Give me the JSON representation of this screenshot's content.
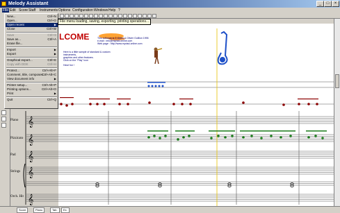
{
  "window": {
    "title": "Melody Assistant"
  },
  "menubar": {
    "items": [
      {
        "label": "File",
        "active": true
      },
      {
        "label": "Edit"
      },
      {
        "label": "Score"
      },
      {
        "label": "Staff"
      },
      {
        "label": "Instruments"
      },
      {
        "label": "Options"
      },
      {
        "label": "Configuration"
      },
      {
        "label": "Windows"
      },
      {
        "label": "Help"
      },
      {
        "label": "?"
      }
    ]
  },
  "tooltip": "File menu loading, saving, exporting, printing operations...",
  "file_menu": {
    "items": [
      {
        "label": "New...",
        "shortcut": "Ctrl+N"
      },
      {
        "label": "Open...",
        "shortcut": "Ctrl+O"
      },
      {
        "label": "Open recent",
        "submenu": true,
        "highlighted": true
      },
      {
        "label": "Close",
        "shortcut": "Ctrl+W"
      },
      {
        "sep": true
      },
      {
        "label": "Save",
        "shortcut": "Ctrl+S",
        "disabled": true
      },
      {
        "label": "Save as...",
        "shortcut": "Ctrl+A"
      },
      {
        "label": "Erase file...",
        "shortcut": ""
      },
      {
        "sep": true
      },
      {
        "label": "Import",
        "submenu": true
      },
      {
        "label": "Export",
        "submenu": true
      },
      {
        "sep": true
      },
      {
        "label": "Graphical export...",
        "shortcut": "Ctrl+E"
      },
      {
        "label": "Copy with DDE",
        "shortcut": "Ctrl+H",
        "disabled": true
      },
      {
        "sep": true
      },
      {
        "label": "Protect...",
        "shortcut": "Ctrl+Alt+F"
      },
      {
        "label": "Comment, title, composer...",
        "shortcut": "Ctrl+Alt+C"
      },
      {
        "label": "View document info",
        "submenu": true
      },
      {
        "sep": true
      },
      {
        "label": "Printer setup...",
        "shortcut": "Ctrl+Alt+P"
      },
      {
        "label": "Printing options...",
        "shortcut": "Ctrl+Alt+O"
      },
      {
        "label": "Print",
        "submenu": true
      },
      {
        "sep": true
      },
      {
        "label": "Quit",
        "shortcut": "Ctrl+Q"
      }
    ]
  },
  "ruler": {
    "marks": [
      "1",
      "2",
      "3",
      "4",
      "5"
    ]
  },
  "document": {
    "welcome": "LCOME",
    "info_lines": [
      "This software is © Didier & Olivier Guillion 1996",
      "e-mail : info@myriad-online.com",
      "Web page : http://www.myriad-online.com"
    ],
    "info2_lines": [
      "Here is a little sample of standard & custom instruments,",
      "graphics and other features.",
      "Click on the \"Play\" icon"
    ],
    "have_fun": "Have fun !"
  },
  "instruments": [
    {
      "label": "Piano"
    },
    {
      "label": "Pizzicato"
    },
    {
      "label": "Pad"
    },
    {
      "label": "Strings"
    },
    {
      "label": "Orch. Hit"
    }
  ],
  "bottom": {
    "tabs": [
      "Score",
      "Piano",
      "Tab.",
      "Ex."
    ]
  },
  "colors": {
    "menu_highlight": "#0a246a",
    "titlebar": "#0a246a",
    "note_red": "#8b0000",
    "note_green": "#1a7a1a",
    "note_blue": "#1e50c8",
    "welcome": "#c00000"
  }
}
